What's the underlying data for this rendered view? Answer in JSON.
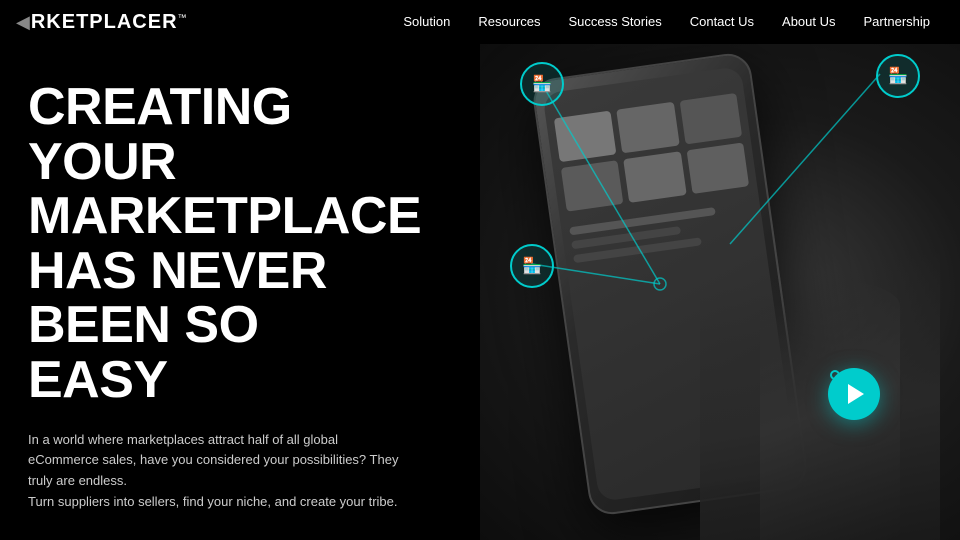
{
  "nav": {
    "logo": "RKETPLACER",
    "logo_tm": "™",
    "links": [
      {
        "label": "Solution",
        "id": "solution"
      },
      {
        "label": "Resources",
        "id": "resources"
      },
      {
        "label": "Success Stories",
        "id": "success-stories"
      },
      {
        "label": "Contact Us",
        "id": "contact-us"
      },
      {
        "label": "About Us",
        "id": "about-us"
      },
      {
        "label": "Partnership",
        "id": "partnership"
      }
    ]
  },
  "hero": {
    "title": "CREATING YOUR MARKETPLACE HAS NEVER BEEN SO EASY",
    "subtitle": "In a world where marketplaces attract half of all global eCommerce sales, have you considered your possibilities? They truly are endless.\nTurn suppliers into sellers, find your niche, and create your tribe."
  },
  "colors": {
    "teal": "#00cccc",
    "bg_dark": "#000000",
    "text_light": "#cccccc"
  }
}
